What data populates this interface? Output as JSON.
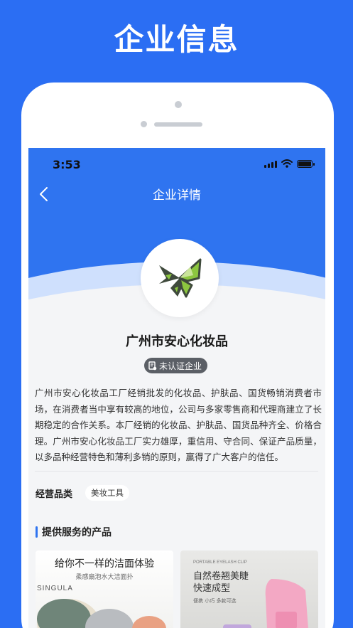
{
  "promo": {
    "title": "企业信息"
  },
  "status_bar": {
    "time": "3:53"
  },
  "nav": {
    "title": "企业详情"
  },
  "company": {
    "name": "广州市安心化妆品",
    "badge": "未认证企业",
    "description": "广州市安心化妆品工厂经销批发的化妆品、护肤品、国货畅销消费者市场，在消费者当中享有较高的地位，公司与多家零售商和代理商建立了长期稳定的合作关系。本厂经销的化妆品、护肤品、国货品种齐全、价格合理。广州市安心化妆品工厂实力雄厚，重信用、守合同、保证产品质量，以多品种经营特色和薄利多销的原则，赢得了广大客户的信任。"
  },
  "category": {
    "label": "经营品类",
    "tags": [
      "美妆工具"
    ]
  },
  "products_section": {
    "title": "提供服务的产品"
  },
  "products": [
    {
      "title": "给你不一样的洁面体验",
      "subtitle": "柔感扇泡水大洁面扑",
      "brand": "SINGULA"
    },
    {
      "small_caption": "PORTABLE EYELASH CLIP",
      "title": "自然卷翘美睫快速成型",
      "subtitle": "便携  小巧  多款可选"
    }
  ],
  "colors": {
    "brand_blue": "#2b6ef3",
    "header_blue": "#2f74f0",
    "badge_gray": "#5b5f66",
    "page_bg": "#f4f5f7",
    "logo_green": "#8cc63f",
    "logo_dark": "#3f4a3c"
  },
  "icons": {
    "back": "chevron-left-icon",
    "badge": "certificate-icon",
    "signal": "cellular-signal-icon",
    "wifi": "wifi-icon",
    "battery": "battery-icon"
  }
}
